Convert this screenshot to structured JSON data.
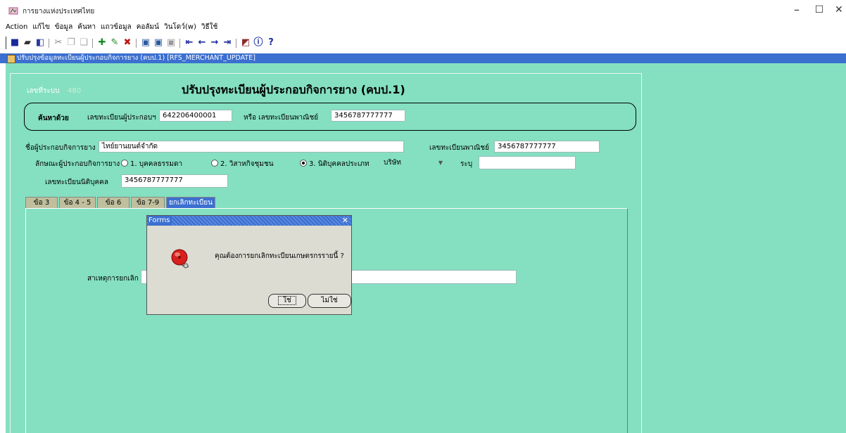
{
  "window": {
    "app_title": "การยางแห่งประเทศไทย",
    "min_glyph": "–",
    "max_glyph": "☐",
    "close_glyph": "✕"
  },
  "menu": [
    "Action",
    "แก้ไข",
    "ข้อมูล",
    "ค้นหา",
    "แถวข้อมูล",
    "คอลัมน์",
    "วินโดว์(w)",
    "วิธีใช้"
  ],
  "toolbar": {
    "icons": [
      "save-icon",
      "print-icon",
      "exit-icon",
      "cut-icon",
      "copy-icon",
      "paste-icon",
      "insert-record-icon",
      "edit-record-icon",
      "delete-record-icon",
      "query-icon",
      "execute-query-icon",
      "cancel-query-icon",
      "first-record-icon",
      "previous-record-icon",
      "next-record-icon",
      "last-record-icon",
      "chart-icon",
      "info-icon",
      "help-icon"
    ]
  },
  "form_window": {
    "caption": "ปรับปรุงข้อมูลทะเบียนผู้ประกอบกิจการยาง (คบป.1) [RFS_MERCHANT_UPDATE]"
  },
  "form": {
    "system_no_label": "เลขที่ระบบ",
    "system_no": "480",
    "title": "ปรับปรุงทะเบียนผู้ประกอบกิจการยาง (คบป.1)",
    "search": {
      "label": "ค้นหาด้วย",
      "reg_no_label": "เลขทะเบียนผู้ประกอบฯ",
      "reg_no": "642206400001",
      "or_commerce_label": "หรือ เลขทะเบียนพาณิชย์",
      "commerce_no": "3456787777777"
    },
    "operator_name_label": "ชื่อผู้ประกอบกิจการยาง",
    "operator_name": "ไทย์ยานยนต์จำกัด",
    "commerce_reg_label": "เลขทะเบียนพาณิชย์",
    "commerce_reg": "3456787777777",
    "type_label": "ลักษณะผู้ประกอบกิจการยาง",
    "type_options": [
      "1. บุคคลธรรมดา",
      "2. วิสาหกิจชุมชน",
      "3. นิติบุคคลประเภท"
    ],
    "type_selected": 2,
    "entity_type": "บริษัท",
    "specify_label": "ระบุ",
    "specify_value": "",
    "juristic_no_label": "เลขทะเบียนนิติบุคคล",
    "juristic_no": "3456787777777",
    "cancel_reason_label": "สาเหตุการยกเลิก",
    "cancel_reason": ""
  },
  "tabs": [
    "ข้อ 3",
    "ข้อ 4 - 5",
    "ข้อ 6",
    "ข้อ 7-9",
    "ยกเลิกทะเบียน"
  ],
  "active_tab": 4,
  "dialog": {
    "title": "Forms",
    "close_glyph": "✕",
    "message": "คุณต้องการยกเลิกทะเบียนเกษตรกรรายนี้ ?",
    "yes_label": "ใช่",
    "no_label": "ไม่ใช่"
  },
  "colors": {
    "canvas": "#84e0c0",
    "caption": "#3b6fd0",
    "tab": "#bfbf9e",
    "dialog": "#dcdcd2"
  }
}
